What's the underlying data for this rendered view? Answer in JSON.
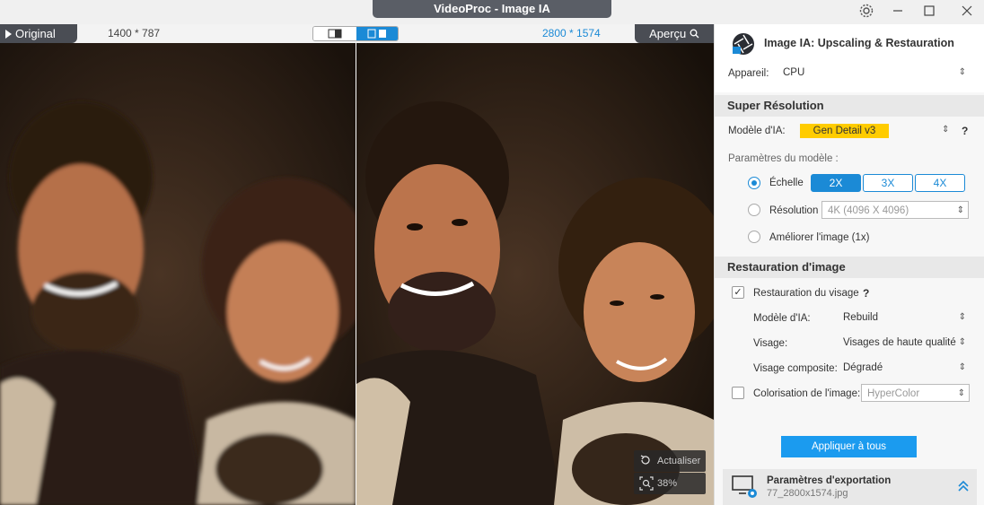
{
  "window": {
    "title": "VideoProc -  Image IA"
  },
  "viewer": {
    "original_label": "Original",
    "original_dims": "1400 * 787",
    "output_dims": "2800 * 1574",
    "preview_label": "Aperçu",
    "refresh_label": "Actualiser",
    "zoom_label": "38%"
  },
  "panel": {
    "title": "Image IA: Upscaling & Restauration",
    "device_label": "Appareil:",
    "device_value": "CPU",
    "super_res": {
      "heading": "Super Résolution",
      "model_label": "Modèle d'IA:",
      "model_value": "Gen Detail v3",
      "help": "?",
      "params_label": "Paramètres du modèle :",
      "scale_label": "Échelle",
      "scale_options": [
        "2X",
        "3X",
        "4X"
      ],
      "resolution_label": "Résolution",
      "resolution_value": "4K (4096 X 4096)",
      "enhance_label": "Améliorer l'image (1x)"
    },
    "restoration": {
      "heading": "Restauration d'image",
      "face_label": "Restauration du visage",
      "help": "?",
      "model_label": "Modèle d'IA:",
      "model_value": "Rebuild",
      "face_type_label": "Visage:",
      "face_type_value": "Visages de haute qualité",
      "composite_label": "Visage composite:",
      "composite_value": "Dégradé",
      "color_label": "Colorisation de l'image:",
      "color_value": "HyperColor"
    },
    "apply_label": "Appliquer à tous",
    "export": {
      "title": "Paramètres d'exportation",
      "file": "77_2800x1574.jpg"
    }
  },
  "colors": {
    "accent": "#1b8ad6",
    "model_badge": "#ffcc00"
  }
}
